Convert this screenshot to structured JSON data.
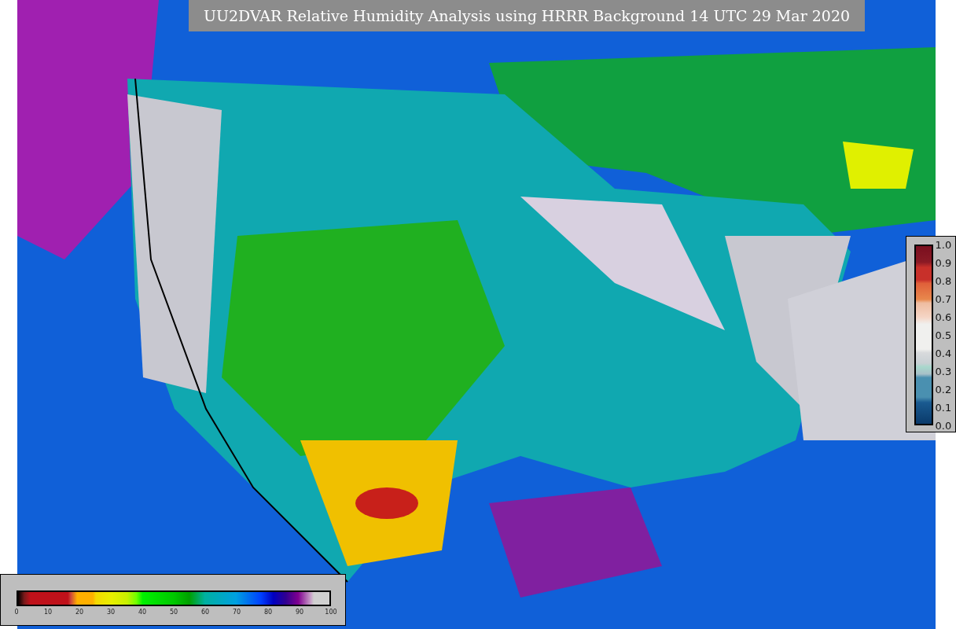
{
  "title": "UU2DVAR Relative Humidity Analysis using HRRR Background 14 UTC 29 Mar 2020",
  "main_colorbar": {
    "ticks": [
      "0",
      "10",
      "20",
      "30",
      "40",
      "50",
      "60",
      "70",
      "80",
      "90",
      "100"
    ]
  },
  "side_colorbar": {
    "ticks": [
      "1.0",
      "0.9",
      "0.8",
      "0.7",
      "0.6",
      "0.5",
      "0.4",
      "0.3",
      "0.2",
      "0.1",
      "0.0"
    ]
  }
}
